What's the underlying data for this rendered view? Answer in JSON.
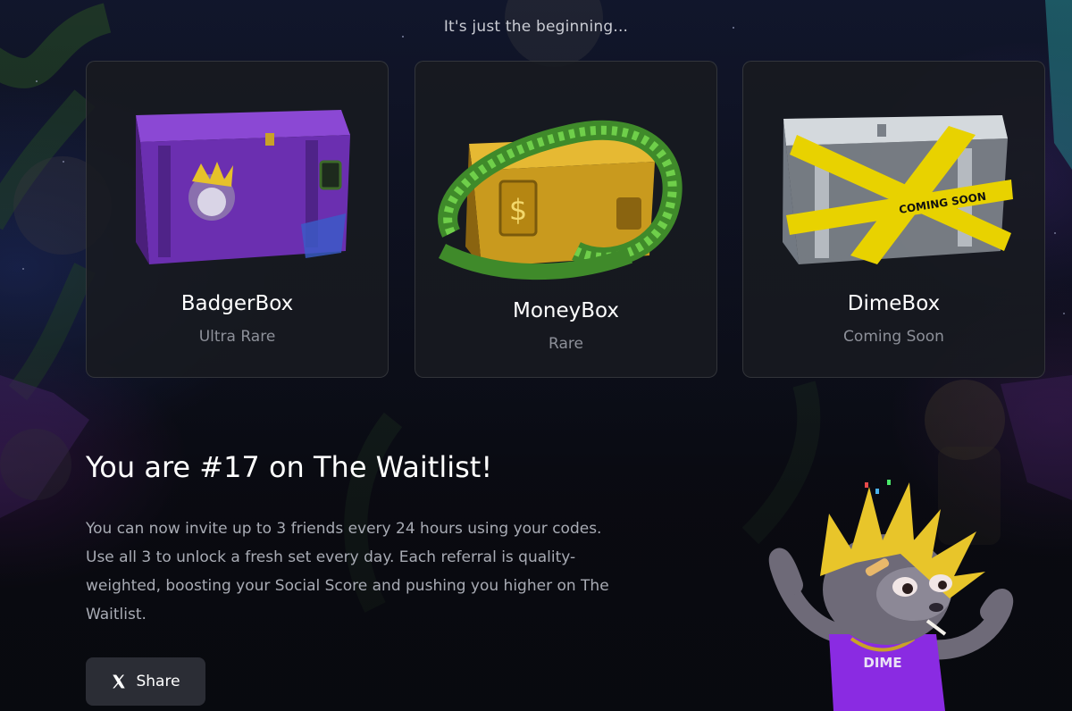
{
  "header": {
    "tagline": "It's just the beginning..."
  },
  "boxes": [
    {
      "name": "BadgerBox",
      "rarity": "Ultra Rare",
      "art_icon": "purple-crate-icon",
      "color": "#6b2fb0"
    },
    {
      "name": "MoneyBox",
      "rarity": "Rare",
      "art_icon": "gold-crate-icon",
      "color": "#c99a1e"
    },
    {
      "name": "DimeBox",
      "rarity": "Coming Soon",
      "art_icon": "glass-crate-icon",
      "color": "#e8d200",
      "tape_text": "COMING SOON"
    }
  ],
  "waitlist": {
    "title": "You are #17 on The Waitlist!",
    "description": "You can now invite up to 3 friends every 24 hours using your codes. Use all 3 to unlock a fresh set every day. Each referral is quality-weighted, boosting your Social Score and pushing you higher on The Waitlist."
  },
  "share_button": {
    "label": "Share",
    "icon": "x-logo-icon"
  },
  "mascot": {
    "shirt_text": "DIME",
    "shirt_color": "#8a2be2"
  },
  "colors": {
    "background": "#0d0f18",
    "card": "#181a20",
    "button": "#2b2d35",
    "muted_text": "#8d9099"
  }
}
